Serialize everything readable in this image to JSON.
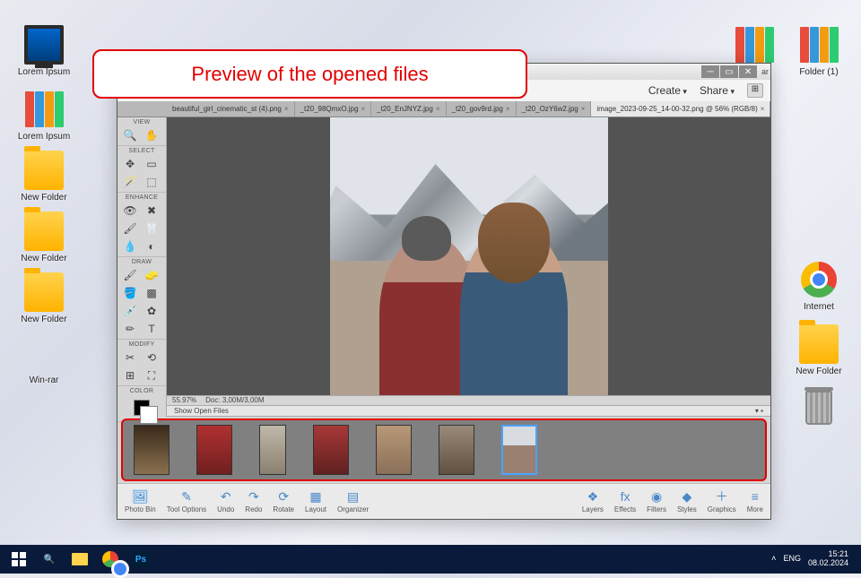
{
  "annotation": {
    "text": "Preview of the opened files"
  },
  "desktop": {
    "icons_left": [
      {
        "name": "pc",
        "label": "Lorem Ipsum"
      },
      {
        "name": "binders",
        "label": "Lorem Ipsum"
      },
      {
        "name": "folder",
        "label": "New Folder"
      },
      {
        "name": "folder",
        "label": "New Folder"
      },
      {
        "name": "folder",
        "label": "New Folder"
      },
      {
        "name": "archive",
        "label": "Win-rar"
      }
    ],
    "icons_right": [
      {
        "name": "binders",
        "label": ""
      },
      {
        "name": "binders",
        "label": "Folder (1)"
      },
      {
        "name": "chrome",
        "label": "Internet"
      },
      {
        "name": "folder",
        "label": "New Folder"
      },
      {
        "name": "trash",
        "label": ""
      }
    ]
  },
  "app": {
    "titlebar_right": "ar",
    "menubar": {
      "create": "Create",
      "share": "Share"
    },
    "tabs": [
      {
        "label": "beautiful_girl_cinematic_st (4).png",
        "active": false
      },
      {
        "label": "_t20_98QmxO.jpg",
        "active": false
      },
      {
        "label": "_t20_EnJNYZ.jpg",
        "active": false
      },
      {
        "label": "_t20_gov9rd.jpg",
        "active": false
      },
      {
        "label": "_t20_OzY6w2.jpg",
        "active": false
      },
      {
        "label": "image_2023-09-25_14-00-32.png @ 56% (RGB/8)",
        "active": true
      }
    ],
    "toolbox": {
      "sections": [
        {
          "title": "VIEW",
          "tools": [
            "🔍",
            "✋"
          ]
        },
        {
          "title": "SELECT",
          "tools": [
            "✥",
            "▭",
            "🪄",
            "⬚"
          ]
        },
        {
          "title": "ENHANCE",
          "tools": [
            "👁",
            "✖",
            "🖌",
            "🦷",
            "💧",
            "◐"
          ]
        },
        {
          "title": "DRAW",
          "tools": [
            "🖌",
            "🧽",
            "🪣",
            "▩",
            "💉",
            "✿",
            "✏",
            "T"
          ]
        },
        {
          "title": "MODIFY",
          "tools": [
            "✂",
            "⟲",
            "⊞",
            "⛶"
          ]
        },
        {
          "title": "COLOR",
          "tools": []
        }
      ]
    },
    "status": {
      "zoom": "55.97%",
      "doc": "Doc: 3,00M/3,00M"
    },
    "open_files_label": "Show Open Files",
    "bottombar": {
      "left": [
        {
          "label": "Photo Bin",
          "icon": "🖼"
        },
        {
          "label": "Tool Options",
          "icon": "✎"
        },
        {
          "label": "Undo",
          "icon": "↶"
        },
        {
          "label": "Redo",
          "icon": "↷"
        },
        {
          "label": "Rotate",
          "icon": "⟳"
        },
        {
          "label": "Layout",
          "icon": "▦"
        },
        {
          "label": "Organizer",
          "icon": "▤"
        }
      ],
      "right": [
        {
          "label": "Layers",
          "icon": "❖"
        },
        {
          "label": "Effects",
          "icon": "fx"
        },
        {
          "label": "Filters",
          "icon": "◉"
        },
        {
          "label": "Styles",
          "icon": "◆"
        },
        {
          "label": "Graphics",
          "icon": "＋"
        },
        {
          "label": "More",
          "icon": "≡"
        }
      ]
    }
  },
  "taskbar": {
    "lang": "ENG",
    "time": "15:21",
    "date": "08.02.2024"
  }
}
